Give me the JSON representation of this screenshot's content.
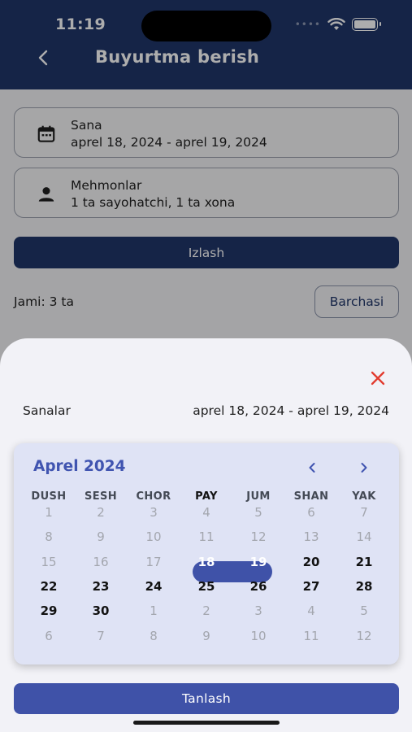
{
  "status_bar": {
    "time": "11:19",
    "dots": "••••"
  },
  "header": {
    "title": "Buyurtma berish"
  },
  "date_field": {
    "label": "Sana",
    "value": "aprel 18, 2024 - aprel 19, 2024",
    "icon": "calendar-icon"
  },
  "guests_field": {
    "label": "Mehmonlar",
    "value": "1 ta sayohatchi, 1 ta xona",
    "icon": "person-icon"
  },
  "search_button": {
    "label": "Izlash"
  },
  "results": {
    "total": "Jami: 3 ta",
    "all_button": "Barchasi"
  },
  "sheet": {
    "range_label": "Sanalar",
    "range_value": "aprel 18, 2024 - aprel 19, 2024",
    "apply_button": "Tanlash"
  },
  "calendar": {
    "month_title": "Aprel 2024",
    "weekdays": [
      "DUSH",
      "SESH",
      "CHOR",
      "PAY",
      "JUM",
      "SHAN",
      "YAK"
    ],
    "highlighted_weekday": "PAY",
    "weeks": [
      [
        {
          "d": "1",
          "s": "muted"
        },
        {
          "d": "2",
          "s": "muted"
        },
        {
          "d": "3",
          "s": "muted"
        },
        {
          "d": "4",
          "s": "muted"
        },
        {
          "d": "5",
          "s": "muted"
        },
        {
          "d": "6",
          "s": "muted"
        },
        {
          "d": "7",
          "s": "muted"
        }
      ],
      [
        {
          "d": "8",
          "s": "muted"
        },
        {
          "d": "9",
          "s": "muted"
        },
        {
          "d": "10",
          "s": "muted"
        },
        {
          "d": "11",
          "s": "muted"
        },
        {
          "d": "12",
          "s": "muted"
        },
        {
          "d": "13",
          "s": "muted"
        },
        {
          "d": "14",
          "s": "muted"
        }
      ],
      [
        {
          "d": "15",
          "s": "muted"
        },
        {
          "d": "16",
          "s": "muted"
        },
        {
          "d": "17",
          "s": "muted"
        },
        {
          "d": "18",
          "s": "selected"
        },
        {
          "d": "19",
          "s": "selected"
        },
        {
          "d": "20",
          "s": "current"
        },
        {
          "d": "21",
          "s": "current"
        }
      ],
      [
        {
          "d": "22",
          "s": "current"
        },
        {
          "d": "23",
          "s": "current"
        },
        {
          "d": "24",
          "s": "current"
        },
        {
          "d": "25",
          "s": "current"
        },
        {
          "d": "26",
          "s": "current"
        },
        {
          "d": "27",
          "s": "current"
        },
        {
          "d": "28",
          "s": "current"
        }
      ],
      [
        {
          "d": "29",
          "s": "current"
        },
        {
          "d": "30",
          "s": "current"
        },
        {
          "d": "1",
          "s": "muted"
        },
        {
          "d": "2",
          "s": "muted"
        },
        {
          "d": "3",
          "s": "muted"
        },
        {
          "d": "4",
          "s": "muted"
        },
        {
          "d": "5",
          "s": "muted"
        }
      ],
      [
        {
          "d": "6",
          "s": "muted"
        },
        {
          "d": "7",
          "s": "muted"
        },
        {
          "d": "8",
          "s": "muted"
        },
        {
          "d": "9",
          "s": "muted"
        },
        {
          "d": "10",
          "s": "muted"
        },
        {
          "d": "11",
          "s": "muted"
        },
        {
          "d": "12",
          "s": "muted"
        }
      ]
    ],
    "selected_range": [
      "aprel 18, 2024",
      "aprel 19, 2024"
    ]
  },
  "colors": {
    "primary": "#1f3569",
    "accent": "#3f52a8",
    "close_red": "#e23b2e",
    "calendar_bg": "#dfe3f5"
  }
}
